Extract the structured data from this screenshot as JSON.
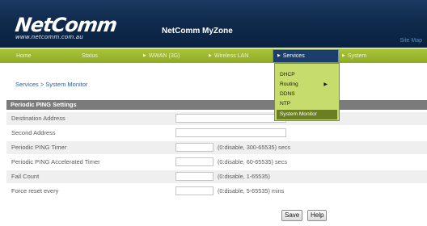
{
  "header": {
    "logo_text": "NetComm",
    "logo_url": "www.netcomm.com.au",
    "title": "NetComm MyZone",
    "sitemap_label": "Site Map"
  },
  "nav": {
    "items": [
      {
        "label": "Home"
      },
      {
        "label": "Status"
      },
      {
        "label": "WWAN (3G)"
      },
      {
        "label": "Wireless LAN"
      },
      {
        "label": "Services"
      },
      {
        "label": "System"
      }
    ]
  },
  "dropdown": {
    "items": [
      {
        "label": "DHCP"
      },
      {
        "label": "Routing"
      },
      {
        "label": "DDNS"
      },
      {
        "label": "NTP"
      },
      {
        "label": "System Monitor"
      }
    ]
  },
  "breadcrumb": "Services > System Monitor",
  "section": {
    "title": "Periodic PING Settings",
    "rows": [
      {
        "label": "Destination Address",
        "value": "",
        "hint": ""
      },
      {
        "label": "Second Address",
        "value": "",
        "hint": ""
      },
      {
        "label": "Periodic PING Timer",
        "value": "",
        "hint": "(0:disable, 300-65535) secs"
      },
      {
        "label": "Periodic PING Accelerated Timer",
        "value": "",
        "hint": "(0:disable, 60-65535) secs"
      },
      {
        "label": "Fail Count",
        "value": "",
        "hint": "(0:disable, 1-65535)"
      },
      {
        "label": "Force reset every",
        "value": "",
        "hint": "(0:disable, 5-65535) mins"
      }
    ]
  },
  "buttons": {
    "save": "Save",
    "help": "Help"
  },
  "colors": {
    "header_bg": "#0f2a4c",
    "nav_bg": "#9bb82e",
    "nav_active": "#1d3e6a",
    "dropdown_bg": "#c6dc6c",
    "section_header": "#7b7b7b",
    "link": "#2f5f9c"
  }
}
